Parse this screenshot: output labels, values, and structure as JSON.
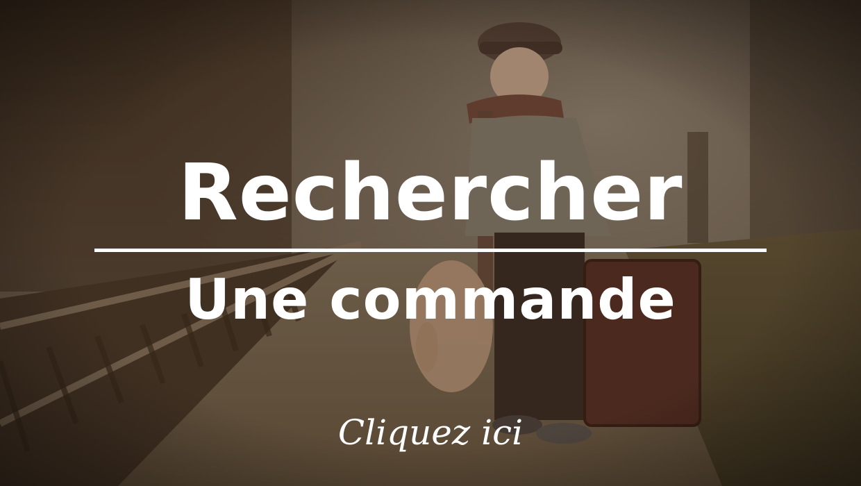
{
  "banner": {
    "title": "Rechercher",
    "subtitle": "Une commande",
    "cta_label": "Cliquez ici"
  },
  "colors": {
    "text": "#ffffff",
    "tint": "#3a2e22"
  }
}
